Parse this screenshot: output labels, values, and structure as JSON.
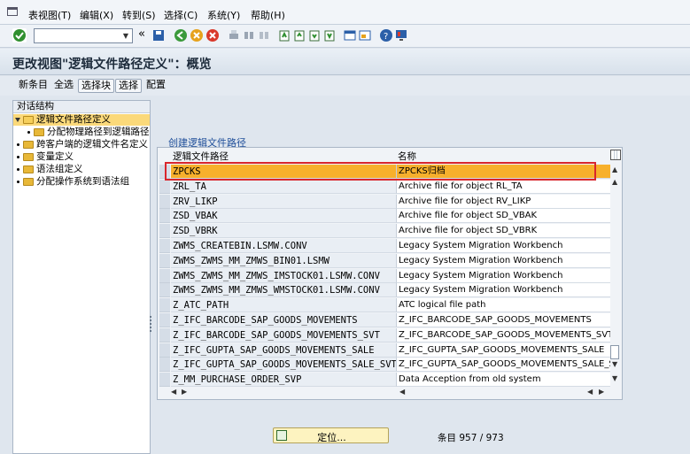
{
  "menu": {
    "items": [
      {
        "label": "表视图(T)"
      },
      {
        "label": "编辑(X)"
      },
      {
        "label": "转到(S)"
      },
      {
        "label": "选择(C)"
      },
      {
        "label": "系统(Y)"
      },
      {
        "label": "帮助(H)"
      }
    ]
  },
  "toolbar": {
    "command_field_value": ""
  },
  "title": "更改视图\"逻辑文件路径定义\"：概览",
  "app_toolbar": {
    "new_entries": "新条目",
    "select_all": "全选",
    "select_block": "选择块",
    "select": "选择",
    "config": "配置"
  },
  "tree": {
    "header": "对话结构",
    "nodes": [
      {
        "label": "逻辑文件路径定义"
      },
      {
        "label": "分配物理路径到逻辑路径"
      },
      {
        "label": "跨客户端的逻辑文件名定义"
      },
      {
        "label": "变量定义"
      },
      {
        "label": "语法组定义"
      },
      {
        "label": "分配操作系统到语法组"
      }
    ]
  },
  "table": {
    "title": "创建逻辑文件路径",
    "columns": [
      "逻辑文件路径",
      "名称"
    ],
    "rows": [
      {
        "path": "ZPCKS",
        "name": "ZPCKS归档"
      },
      {
        "path": "ZRL_TA",
        "name": "Archive file for object RL_TA"
      },
      {
        "path": "ZRV_LIKP",
        "name": "Archive file for object RV_LIKP"
      },
      {
        "path": "ZSD_VBAK",
        "name": "Archive file for object SD_VBAK"
      },
      {
        "path": "ZSD_VBRK",
        "name": "Archive file for object SD_VBRK"
      },
      {
        "path": "ZWMS_CREATEBIN.LSMW.CONV",
        "name": "Legacy System Migration Workbench"
      },
      {
        "path": "ZWMS_ZWMS_MM_ZMWS_BIN01.LSMW",
        "name": "Legacy System Migration Workbench"
      },
      {
        "path": "ZWMS_ZWMS_MM_ZMWS_IMSTOCK01.LSMW.CONV",
        "name": "Legacy System Migration Workbench"
      },
      {
        "path": "ZWMS_ZWMS_MM_ZMWS_WMSTOCK01.LSMW.CONV",
        "name": "Legacy System Migration Workbench"
      },
      {
        "path": "Z_ATC_PATH",
        "name": "ATC logical file path"
      },
      {
        "path": "Z_IFC_BARCODE_SAP_GOODS_MOVEMENTS",
        "name": "Z_IFC_BARCODE_SAP_GOODS_MOVEMENTS"
      },
      {
        "path": "Z_IFC_BARCODE_SAP_GOODS_MOVEMENTS_SVT",
        "name": "Z_IFC_BARCODE_SAP_GOODS_MOVEMENTS_SVT"
      },
      {
        "path": "Z_IFC_GUPTA_SAP_GOODS_MOVEMENTS_SALE",
        "name": "Z_IFC_GUPTA_SAP_GOODS_MOVEMENTS_SALE"
      },
      {
        "path": "Z_IFC_GUPTA_SAP_GOODS_MOVEMENTS_SALE_SVT",
        "name": "Z_IFC_GUPTA_SAP_GOODS_MOVEMENTS_SALE_SVT"
      },
      {
        "path": "Z_MM_PURCHASE_ORDER_SVP",
        "name": "Data Accept​ion from old system"
      }
    ]
  },
  "footer": {
    "position_button": "定位...",
    "entry_count": "条目 957 / 973"
  },
  "colors": {
    "selected_row": "#f7b02c",
    "highlight_border": "#d9262c",
    "tree_selected": "#fbd97a"
  }
}
